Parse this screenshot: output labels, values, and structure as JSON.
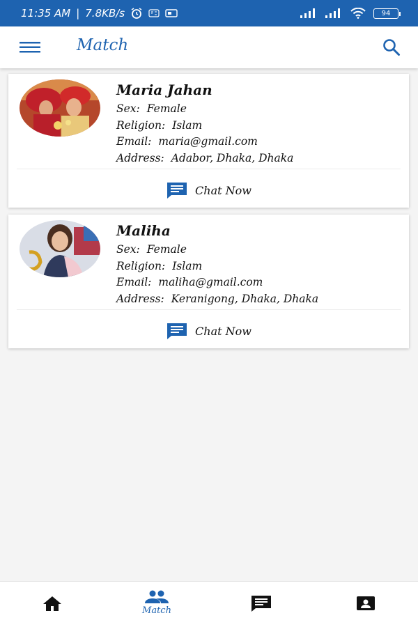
{
  "status_bar": {
    "time": "11:35 AM",
    "speed": "7.8KB/s",
    "battery": "94"
  },
  "app_bar": {
    "title": "Match"
  },
  "matches": [
    {
      "name": "Maria Jahan",
      "sex_label": "Sex:",
      "sex": "Female",
      "religion_label": "Religion:",
      "religion": "Islam",
      "email_label": "Email:",
      "email": "maria@gmail.com",
      "address_label": "Address:",
      "address": "Adabor, Dhaka, Dhaka",
      "chat_label": "Chat Now"
    },
    {
      "name": "Maliha",
      "sex_label": "Sex:",
      "sex": "Female",
      "religion_label": "Religion:",
      "religion": "Islam",
      "email_label": "Email:",
      "email": "maliha@gmail.com",
      "address_label": "Address:",
      "address": "Keranigong, Dhaka, Dhaka",
      "chat_label": "Chat Now"
    }
  ],
  "bottom_nav": {
    "items": [
      {
        "icon": "home-icon",
        "label": ""
      },
      {
        "icon": "people-icon",
        "label": "Match"
      },
      {
        "icon": "chat-icon",
        "label": ""
      },
      {
        "icon": "profile-card-icon",
        "label": ""
      }
    ],
    "active_index": 1
  },
  "colors": {
    "primary": "#1e63b0",
    "background": "#f4f4f4"
  }
}
